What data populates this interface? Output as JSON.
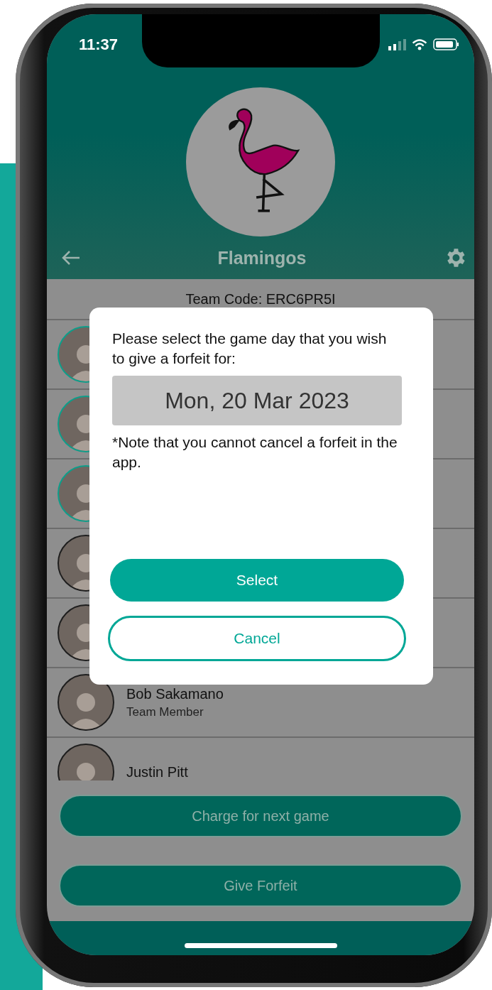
{
  "status_bar": {
    "time": "11:37"
  },
  "team": {
    "name": "Flamingos",
    "code_label": "Team Code: ERC6PR5I"
  },
  "members": [
    {
      "color": "#0d9e8a"
    },
    {
      "color": "#0d9e8a"
    },
    {
      "color": "#0d9e8a"
    },
    {
      "color": "#1e1e1e"
    },
    {
      "color": "#1e1e1e"
    },
    {
      "name": "Bob Sakamano",
      "role": "Team Member",
      "color": "#1e1e1e"
    },
    {
      "name": "Justin Pitt",
      "color": "#1e1e1e"
    }
  ],
  "actions": [
    "Charge for next game",
    "Give Forfeit"
  ],
  "dialog": {
    "message": "Please select the game day that you wish to give a forfeit for:",
    "date": "Mon, 20 Mar 2023",
    "note": "*Note that you cannot cancel a forfeit in the app.",
    "buttons": [
      {
        "label": "Select",
        "kind": "primary"
      },
      {
        "label": "Cancel",
        "kind": "secondary"
      }
    ]
  }
}
